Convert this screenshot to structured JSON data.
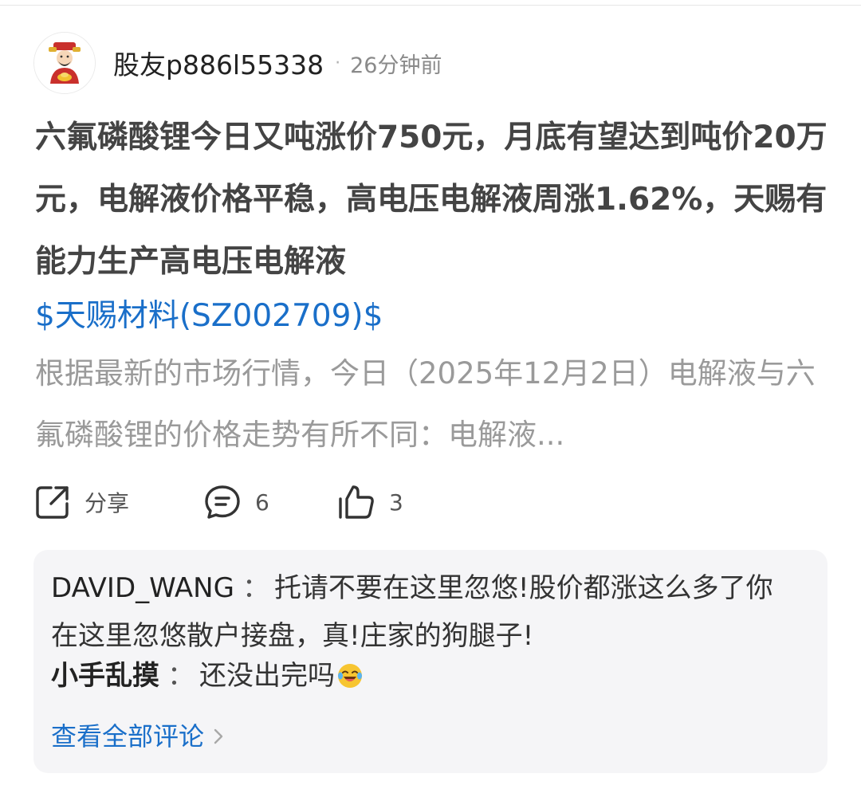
{
  "post": {
    "author": "股友p886l55338",
    "time_ago": "26分钟前",
    "separator": "·",
    "headline": "六氟磷酸锂今日又吨涨价750元，月底有望达到吨价20万元，电解液价格平稳，高电压电解液周涨1.62%，天赐有能力生产高电压电解液",
    "stock_link": "$天赐材料(SZ002709)$",
    "summary": "根据最新的市场行情，今日（2025年12月2日）电解液与六氟磷酸锂的价格走势有所不同：电解液..."
  },
  "actions": {
    "share_label": "分享",
    "comment_count": "6",
    "like_count": "3"
  },
  "comments": {
    "items": [
      {
        "author": "DAVID_WANG",
        "separator": "：",
        "text": "托请不要在这里忽悠!股价都涨这么多了你在这里忽悠散户接盘，真!庄家的狗腿子!"
      },
      {
        "author": "小手乱摸",
        "separator": "：",
        "text": "还没出完吗",
        "emoji": "laughing-tears-emoji"
      }
    ],
    "view_all_label": "查看全部评论"
  },
  "colors": {
    "link": "#1a6fc9",
    "headline": "#444444",
    "summary": "#9a9a9a",
    "comment_bg": "#f5f5f7"
  }
}
